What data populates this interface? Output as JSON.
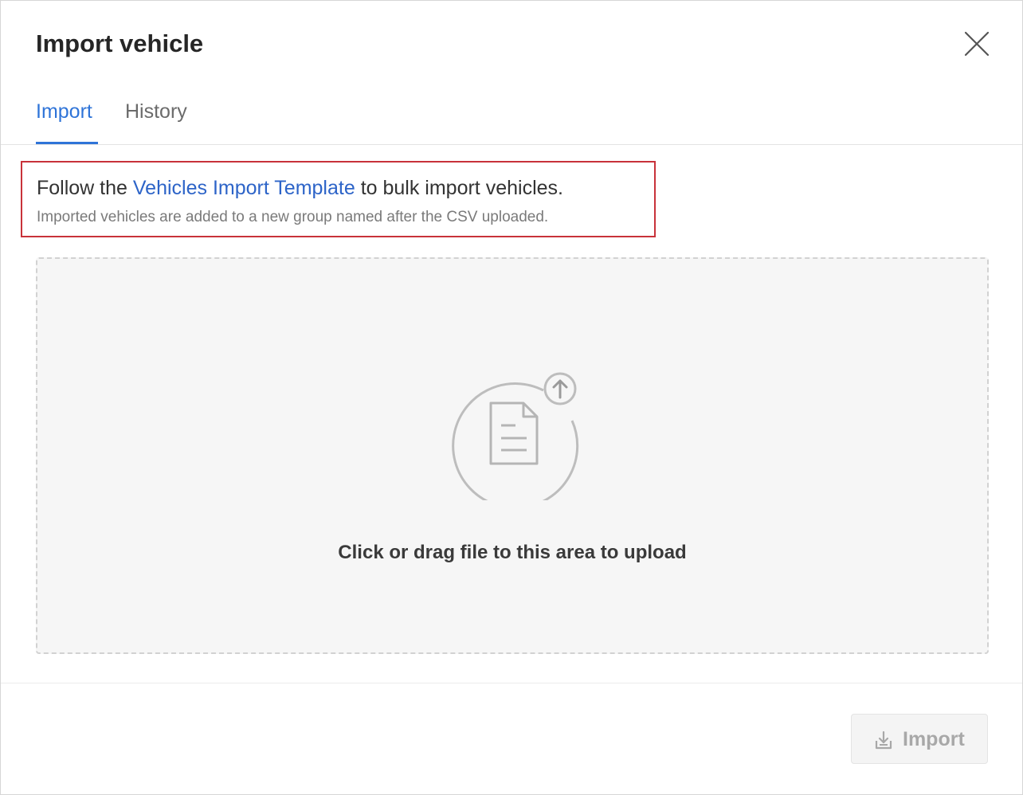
{
  "modal": {
    "title": "Import vehicle",
    "close_icon": "close-icon"
  },
  "tabs": [
    {
      "label": "Import",
      "active": true
    },
    {
      "label": "History",
      "active": false
    }
  ],
  "info": {
    "prefix": "Follow the ",
    "link": "Vehicles Import Template",
    "suffix": " to bulk import vehicles.",
    "subtext": "Imported vehicles are added to a new group named after the CSV uploaded."
  },
  "dropzone": {
    "icon": "file-upload-icon",
    "text": "Click or drag file to this area to upload"
  },
  "footer": {
    "import_button": {
      "label": "Import",
      "icon": "import-icon",
      "disabled": true
    }
  },
  "colors": {
    "accent": "#2f74d8",
    "link": "#2d64c8",
    "highlight_border": "#c8323a",
    "dropzone_bg": "#f6f6f6",
    "disabled_text": "#a8a8a8"
  }
}
